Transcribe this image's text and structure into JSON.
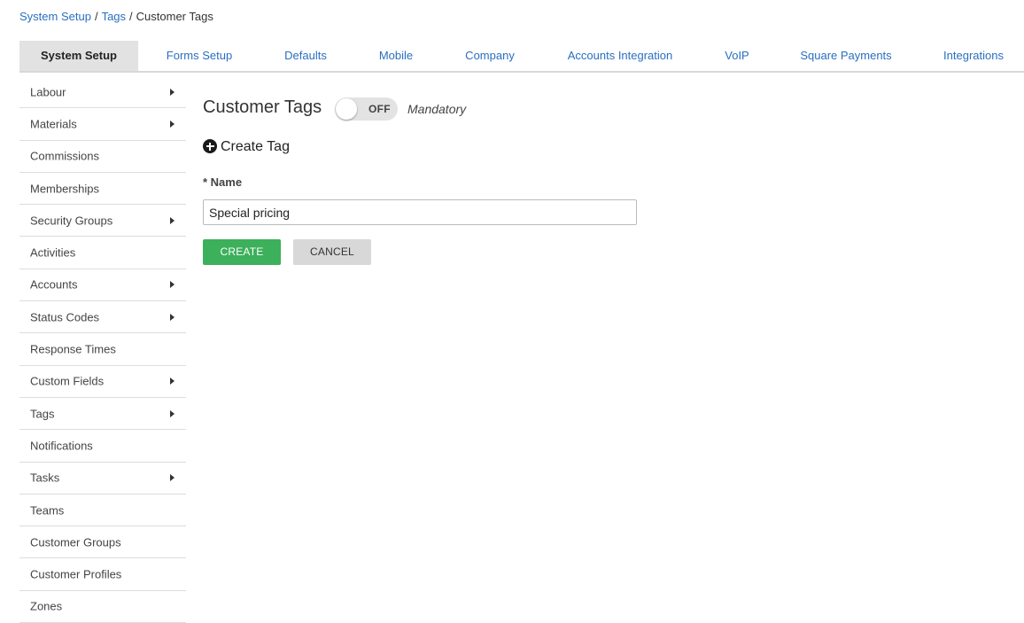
{
  "breadcrumb": {
    "items": [
      "System Setup",
      "Tags"
    ],
    "separator": "/",
    "current": "Customer Tags"
  },
  "tabs": [
    {
      "label": "System Setup",
      "active": true
    },
    {
      "label": "Forms Setup",
      "active": false
    },
    {
      "label": "Defaults",
      "active": false
    },
    {
      "label": "Mobile",
      "active": false
    },
    {
      "label": "Company",
      "active": false
    },
    {
      "label": "Accounts Integration",
      "active": false
    },
    {
      "label": "VoIP",
      "active": false
    },
    {
      "label": "Square Payments",
      "active": false
    },
    {
      "label": "Integrations",
      "active": false
    }
  ],
  "sidebar": {
    "items": [
      {
        "label": "Labour",
        "has_submenu": true
      },
      {
        "label": "Materials",
        "has_submenu": true
      },
      {
        "label": "Commissions",
        "has_submenu": false
      },
      {
        "label": "Memberships",
        "has_submenu": false
      },
      {
        "label": "Security Groups",
        "has_submenu": true
      },
      {
        "label": "Activities",
        "has_submenu": false
      },
      {
        "label": "Accounts",
        "has_submenu": true
      },
      {
        "label": "Status Codes",
        "has_submenu": true
      },
      {
        "label": "Response Times",
        "has_submenu": false
      },
      {
        "label": "Custom Fields",
        "has_submenu": true
      },
      {
        "label": "Tags",
        "has_submenu": true
      },
      {
        "label": "Notifications",
        "has_submenu": false
      },
      {
        "label": "Tasks",
        "has_submenu": true
      },
      {
        "label": "Teams",
        "has_submenu": false
      },
      {
        "label": "Customer Groups",
        "has_submenu": false
      },
      {
        "label": "Customer Profiles",
        "has_submenu": false
      },
      {
        "label": "Zones",
        "has_submenu": false
      }
    ]
  },
  "main": {
    "title": "Customer Tags",
    "toggle": {
      "state_label": "OFF",
      "checked": false
    },
    "mandatory_label": "Mandatory",
    "create_tag_label": "Create Tag",
    "form": {
      "name_label": "* Name",
      "name_value": "Special pricing",
      "create_button": "CREATE",
      "cancel_button": "CANCEL"
    }
  },
  "colors": {
    "link": "#2a6fc0",
    "create_button": "#3cb05a",
    "cancel_button": "#d8d8d8",
    "active_tab_bg": "#e2e2e2"
  }
}
